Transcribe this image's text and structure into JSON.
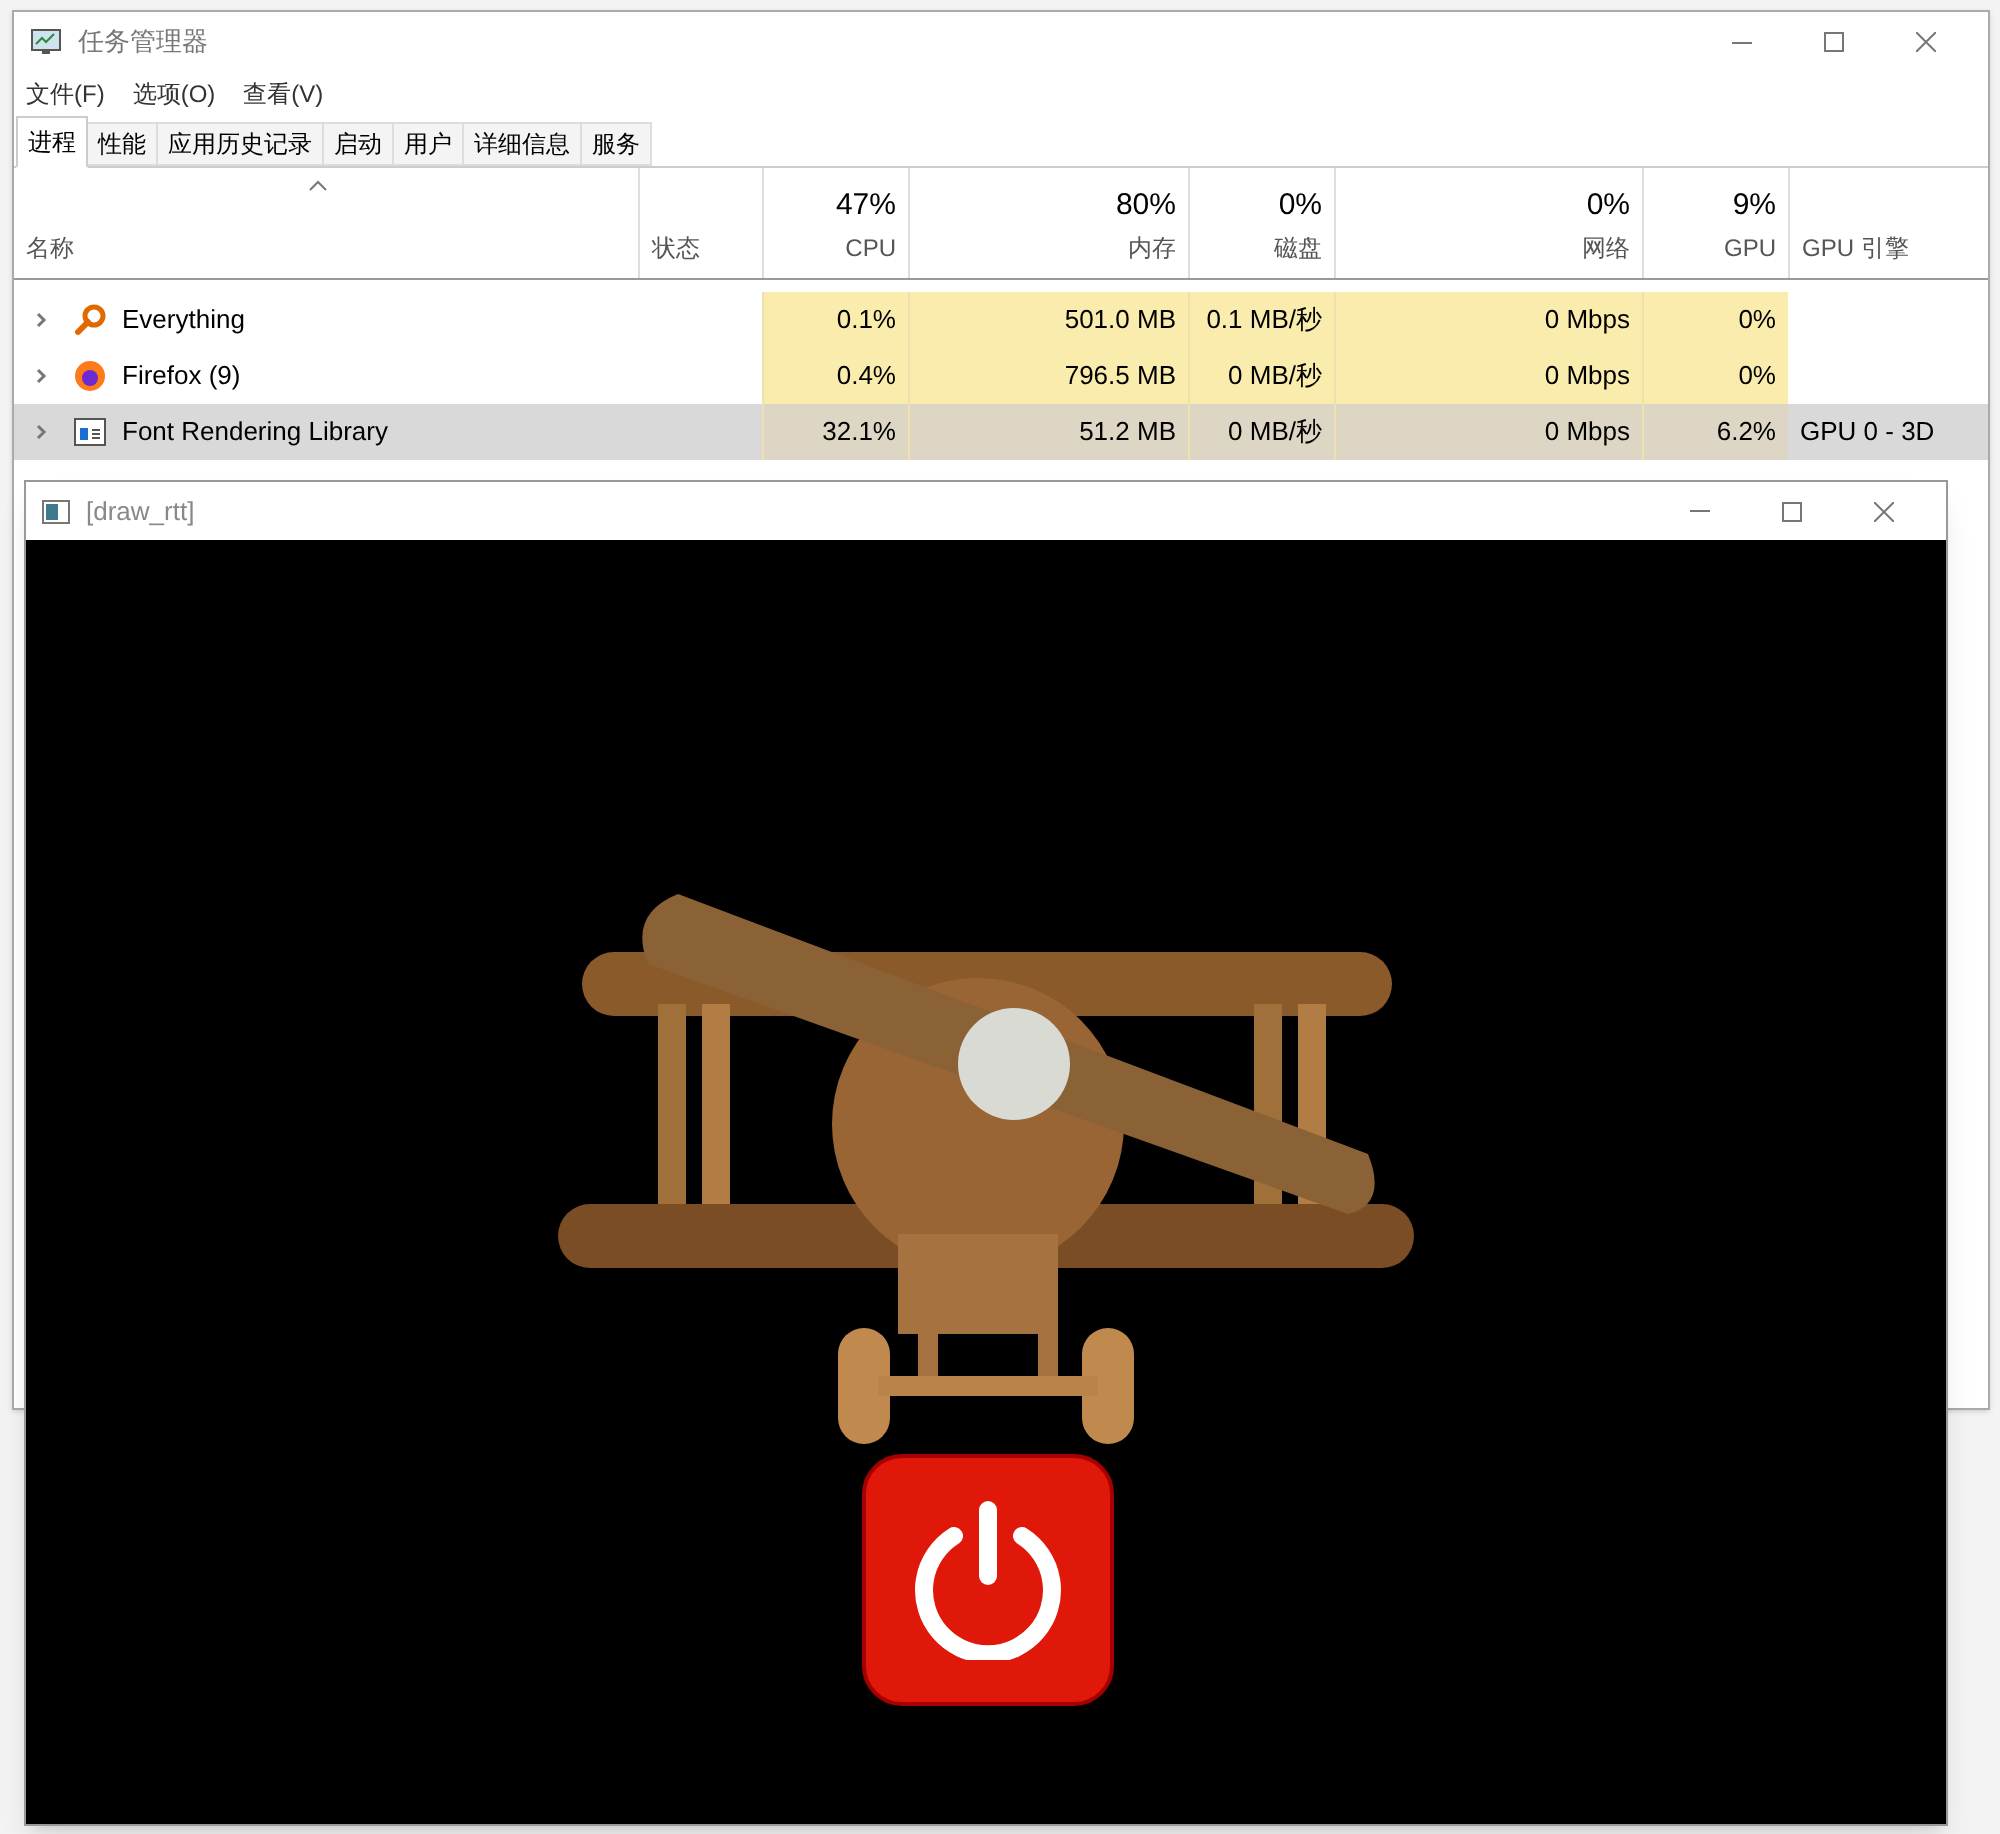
{
  "task_manager": {
    "title": "任务管理器",
    "menu": [
      "文件(F)",
      "选项(O)",
      "查看(V)"
    ],
    "tabs": [
      {
        "label": "进程",
        "selected": true
      },
      {
        "label": "性能",
        "selected": false
      },
      {
        "label": "应用历史记录",
        "selected": false
      },
      {
        "label": "启动",
        "selected": false
      },
      {
        "label": "用户",
        "selected": false
      },
      {
        "label": "详细信息",
        "selected": false
      },
      {
        "label": "服务",
        "selected": false
      }
    ],
    "columns": [
      {
        "label": "名称"
      },
      {
        "label": "状态"
      },
      {
        "label": "CPU",
        "usage": "47%"
      },
      {
        "label": "内存",
        "usage": "80%"
      },
      {
        "label": "磁盘",
        "usage": "0%"
      },
      {
        "label": "网络",
        "usage": "0%"
      },
      {
        "label": "GPU",
        "usage": "9%"
      },
      {
        "label": "GPU 引擎"
      }
    ],
    "rows": [
      {
        "name": "Everything",
        "expanded": false,
        "selected": false,
        "cpu": "0.1%",
        "memory": "501.0 MB",
        "disk": "0.1 MB/秒",
        "network": "0 Mbps",
        "gpu": "0%"
      },
      {
        "name": "Firefox (9)",
        "expanded": false,
        "selected": false,
        "cpu": "0.4%",
        "memory": "796.5 MB",
        "disk": "0 MB/秒",
        "network": "0 Mbps",
        "gpu": "0%"
      },
      {
        "name": "Font Rendering Library",
        "expanded": false,
        "selected": true,
        "cpu": "32.1%",
        "memory": "51.2 MB",
        "disk": "0 MB/秒",
        "network": "0 Mbps",
        "gpu": "6.2%",
        "gpu_engine": "GPU 0 - 3D"
      }
    ]
  },
  "render_window": {
    "title": "[draw_rtt]"
  }
}
